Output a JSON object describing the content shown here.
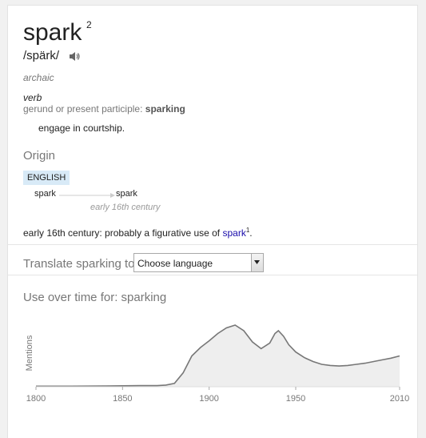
{
  "entry": {
    "word": "spark",
    "superscript": "2",
    "pronunciation": "/spärk/",
    "usage_label": "archaic",
    "part_of_speech": "verb",
    "form_label": "gerund or present participle: ",
    "form_value": "sparking",
    "definition": "engage in courtship."
  },
  "origin": {
    "heading": "Origin",
    "language": "ENGLISH",
    "from_word": "spark",
    "to_word": "spark",
    "date": "early 16th century",
    "text_before": "early 16th century: probably a figurative use of ",
    "link_text": "spark",
    "link_sup": "1",
    "text_after": "."
  },
  "translate": {
    "label": "Translate sparking to",
    "selected": "Choose language"
  },
  "chart_data": {
    "type": "area",
    "title": "Use over time for: sparking",
    "ylabel": "Mentions",
    "xlabel": "",
    "x_ticks": [
      "1800",
      "1850",
      "1900",
      "1950",
      "2010"
    ],
    "xlim": [
      1800,
      2010
    ],
    "x": [
      1800,
      1820,
      1840,
      1860,
      1870,
      1875,
      1880,
      1885,
      1890,
      1895,
      1900,
      1905,
      1910,
      1915,
      1920,
      1925,
      1930,
      1935,
      1938,
      1940,
      1943,
      1946,
      1950,
      1955,
      1960,
      1965,
      1970,
      1975,
      1980,
      1985,
      1990,
      1995,
      2000,
      2005,
      2010
    ],
    "values": [
      1,
      1,
      1.5,
      2,
      2,
      3,
      6,
      25,
      55,
      70,
      82,
      95,
      105,
      110,
      100,
      80,
      68,
      78,
      95,
      100,
      90,
      75,
      62,
      52,
      45,
      40,
      38,
      37,
      38,
      40,
      42,
      45,
      48,
      51,
      55
    ],
    "ylim": [
      0,
      120
    ],
    "series_color": "#777777",
    "fill_color": "#eeeeee"
  }
}
